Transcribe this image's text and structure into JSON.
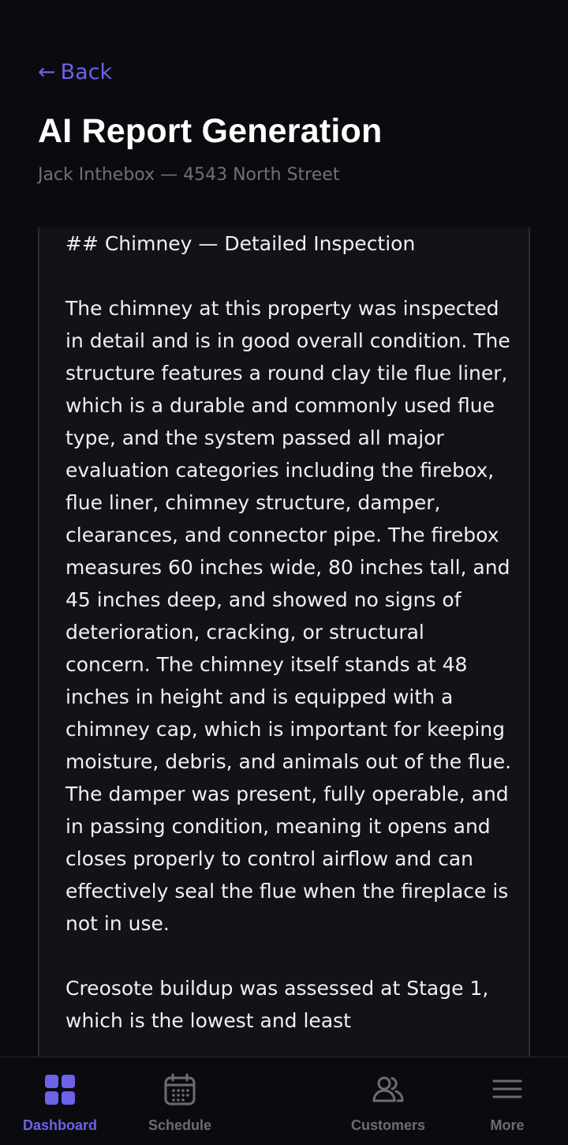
{
  "header": {
    "back_label": "Back",
    "title": "AI Report Generation",
    "subtitle": "Jack Inthebox — 4543 North Street"
  },
  "report": {
    "heading": "## Chimney — Detailed Inspection",
    "paragraphs": [
      "The chimney at this property was inspected in detail and is in good overall condition. The structure features a round clay tile flue liner, which is a durable and commonly used flue type, and the system passed all major evaluation categories including the firebox, flue liner, chimney structure, damper, clearances, and connector pipe. The firebox measures 60 inches wide, 80 inches tall, and 45 inches deep, and showed no signs of deterioration, cracking, or structural concern. The chimney itself stands at 48 inches in height and is equipped with a chimney cap, which is important for keeping moisture, debris, and animals out of the flue. The damper was present, fully operable, and in passing condition, meaning it opens and closes properly to control airflow and can effectively seal the flue when the fireplace is not in use.",
      "Creosote buildup was assessed at Stage 1, which is the lowest and least"
    ]
  },
  "nav": {
    "items": [
      {
        "label": "Dashboard",
        "icon": "dashboard-icon",
        "active": true
      },
      {
        "label": "Schedule",
        "icon": "calendar-icon",
        "active": false
      },
      {
        "label": "Customers",
        "icon": "users-icon",
        "active": false
      },
      {
        "label": "More",
        "icon": "menu-icon",
        "active": false
      }
    ]
  },
  "colors": {
    "accent": "#6c63e8",
    "background": "#0b0b0f",
    "card": "#121217",
    "muted": "#6b6c74"
  }
}
